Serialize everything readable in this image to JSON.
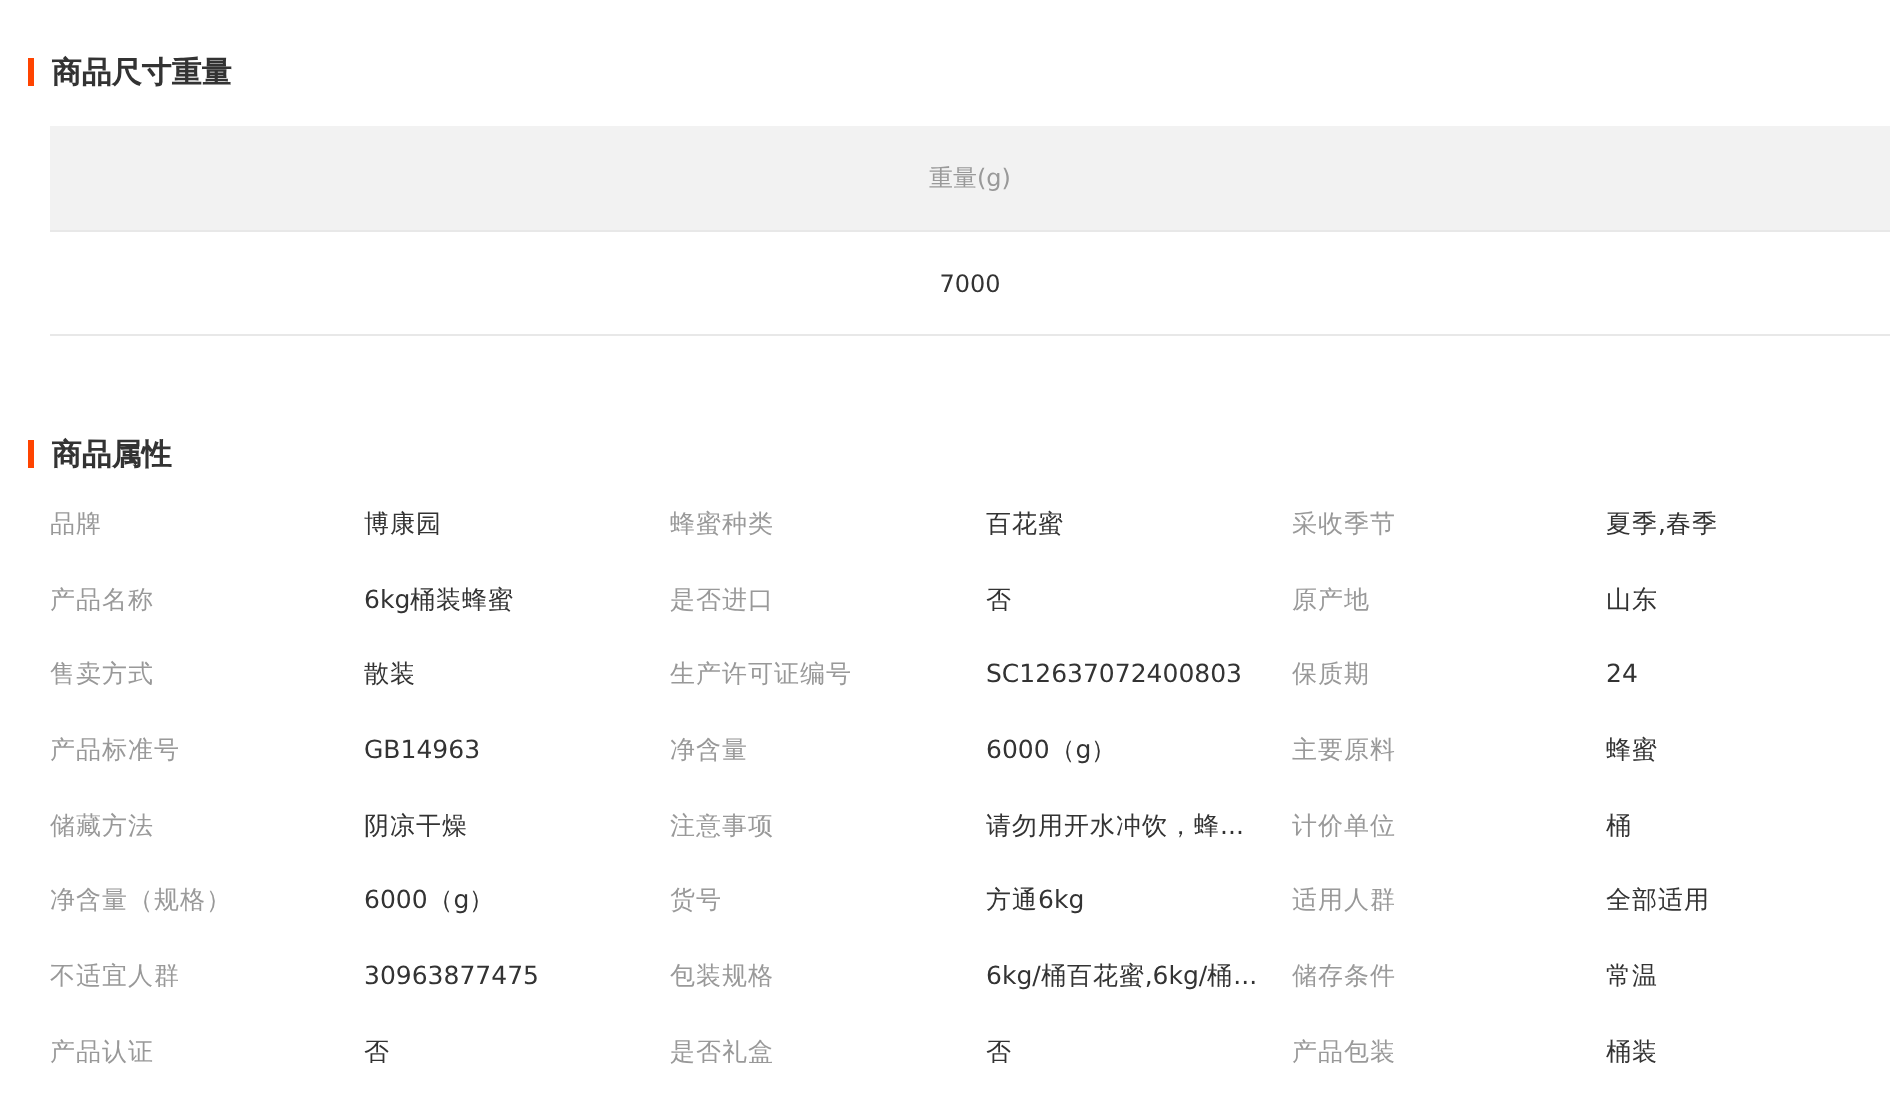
{
  "size_section": {
    "title": "商品尺寸重量",
    "table": {
      "columns": [
        "重量(g)"
      ],
      "rows": [
        [
          "7000"
        ]
      ]
    }
  },
  "attributes_section": {
    "title": "商品属性",
    "attributes": [
      {
        "label": "品牌",
        "value": "博康园"
      },
      {
        "label": "蜂蜜种类",
        "value": "百花蜜"
      },
      {
        "label": "采收季节",
        "value": "夏季,春季"
      },
      {
        "label": "产品名称",
        "value": "6kg桶装蜂蜜"
      },
      {
        "label": "是否进口",
        "value": "否"
      },
      {
        "label": "原产地",
        "value": "山东"
      },
      {
        "label": "售卖方式",
        "value": "散装"
      },
      {
        "label": "生产许可证编号",
        "value": "SC12637072400803"
      },
      {
        "label": "保质期",
        "value": "24"
      },
      {
        "label": "产品标准号",
        "value": "GB14963"
      },
      {
        "label": "净含量",
        "value": "6000（g）"
      },
      {
        "label": "主要原料",
        "value": "蜂蜜"
      },
      {
        "label": "储藏方法",
        "value": "阴凉干燥"
      },
      {
        "label": "注意事项",
        "value": "请勿用开水冲饮，蜂..."
      },
      {
        "label": "计价单位",
        "value": "桶"
      },
      {
        "label": "净含量（规格）",
        "value": "6000（g）"
      },
      {
        "label": "货号",
        "value": "方通6kg"
      },
      {
        "label": "适用人群",
        "value": "全部适用"
      },
      {
        "label": "不适宜人群",
        "value": "30963877475"
      },
      {
        "label": "包装规格",
        "value": "6kg/桶百花蜜,6kg/桶..."
      },
      {
        "label": "储存条件",
        "value": "常温"
      },
      {
        "label": "产品认证",
        "value": "否"
      },
      {
        "label": "是否礼盒",
        "value": "否"
      },
      {
        "label": "产品包装",
        "value": "桶装"
      }
    ]
  }
}
